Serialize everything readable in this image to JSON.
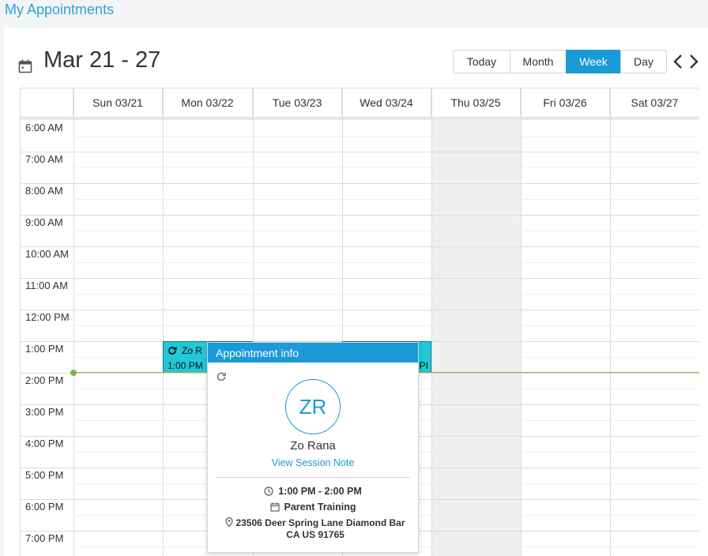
{
  "page": {
    "title": "My Appointments"
  },
  "calendar": {
    "range_title": "Mar 21 - 27",
    "views": [
      {
        "label": "Today",
        "active": false
      },
      {
        "label": "Month",
        "active": false
      },
      {
        "label": "Week",
        "active": true
      },
      {
        "label": "Day",
        "active": false
      }
    ],
    "days": [
      "Sun 03/21",
      "Mon 03/22",
      "Tue 03/23",
      "Wed 03/24",
      "Thu 03/25",
      "Fri 03/26",
      "Sat 03/27"
    ],
    "today_day": "Thu 03/25",
    "hours": [
      "6:00 AM",
      "7:00 AM",
      "8:00 AM",
      "9:00 AM",
      "10:00 AM",
      "11:00 AM",
      "12:00 PM",
      "1:00 PM",
      "2:00 PM",
      "3:00 PM",
      "4:00 PM",
      "5:00 PM",
      "6:00 PM",
      "7:00 PM"
    ],
    "events": [
      {
        "day": "Mon 03/22",
        "title_visible": "Zo R",
        "time_visible": "1:00 PM",
        "recurring": true
      },
      {
        "day": "Wed 03/24",
        "title_visible": "",
        "time_visible": "PI",
        "recurring": false
      }
    ],
    "colors": {
      "accent": "#1a9bd7",
      "event_fill": "#22c8d8",
      "now_line": "#7ab648",
      "today_bg": "#efefef"
    }
  },
  "popup": {
    "header": "Appointment info",
    "initials": "ZR",
    "client_name": "Zo Rana",
    "session_link": "View Session Note",
    "time": "1:00 PM - 2:00 PM",
    "type": "Parent Training",
    "address": "23506 Deer Spring Lane Diamond Bar CA US 91765"
  }
}
